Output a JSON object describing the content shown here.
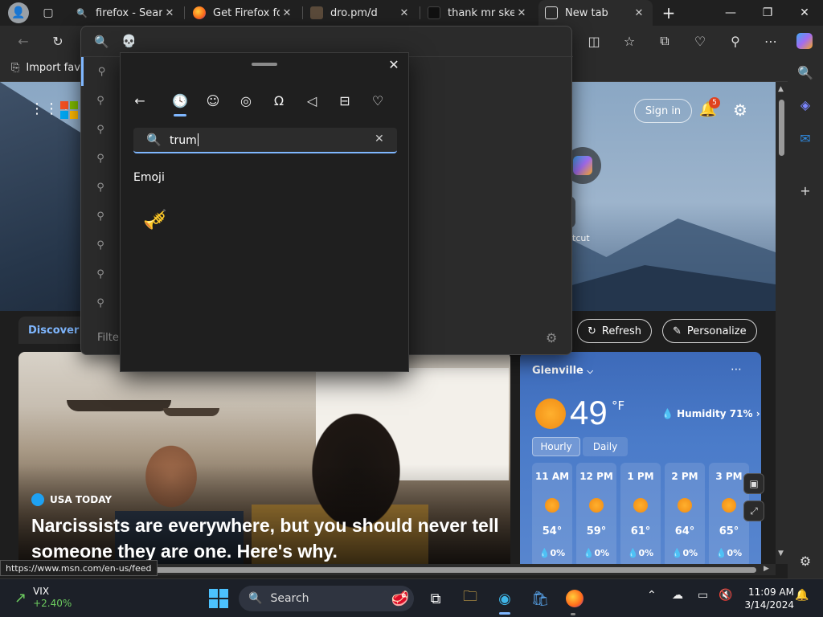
{
  "tabs": [
    {
      "title": "firefox - Search",
      "icon": "search-icon"
    },
    {
      "title": "Get Firefox for",
      "icon": "firefox-icon"
    },
    {
      "title": "dro.pm/d",
      "icon": "image-icon"
    },
    {
      "title": "thank mr skelta",
      "icon": "image-icon"
    },
    {
      "title": "New tab",
      "icon": "newtab-icon",
      "active": true
    }
  ],
  "favorites_bar": {
    "import_label": "Import favo"
  },
  "address_dropdown": {
    "query": "💀",
    "filter_label": "Filter"
  },
  "emoji_panel": {
    "search_value": "trum",
    "section_title": "Emoji",
    "result_emoji": "🎺",
    "categories": [
      "recent-icon",
      "emoji-smiley-icon",
      "kaomoji-icon",
      "symbols-icon",
      "gif-icon",
      "clipboard-icon",
      "favorites-icon"
    ]
  },
  "page": {
    "sign_in": "Sign in",
    "notifications_count": "5",
    "shortcut_label": "tcut",
    "discover_label": "Discover",
    "refresh_label": "Refresh",
    "personalize_label": "Personalize"
  },
  "news": {
    "source": "USA TODAY",
    "headline": "Narcissists are everywhere, but you should never tell someone they are one. Here's why."
  },
  "weather": {
    "location": "Glenville",
    "temperature": "49",
    "unit": "°F",
    "humidity": "Humidity 71%",
    "tab_hourly": "Hourly",
    "tab_daily": "Daily",
    "hours": [
      {
        "time": "11 AM",
        "temp": "54°",
        "precip": "0%"
      },
      {
        "time": "12 PM",
        "temp": "59°",
        "precip": "0%"
      },
      {
        "time": "1 PM",
        "temp": "61°",
        "precip": "0%"
      },
      {
        "time": "2 PM",
        "temp": "64°",
        "precip": "0%"
      },
      {
        "time": "3 PM",
        "temp": "65°",
        "precip": "0%"
      }
    ]
  },
  "status_url": "https://www.msn.com/en-us/feed",
  "taskbar": {
    "ticker_name": "VIX",
    "ticker_change": "+2.40%",
    "search_label": "Search",
    "time": "11:09 AM",
    "date": "3/14/2024"
  },
  "colors": {
    "accent": "#7fb7ff",
    "notification_badge": "#e0421f"
  }
}
